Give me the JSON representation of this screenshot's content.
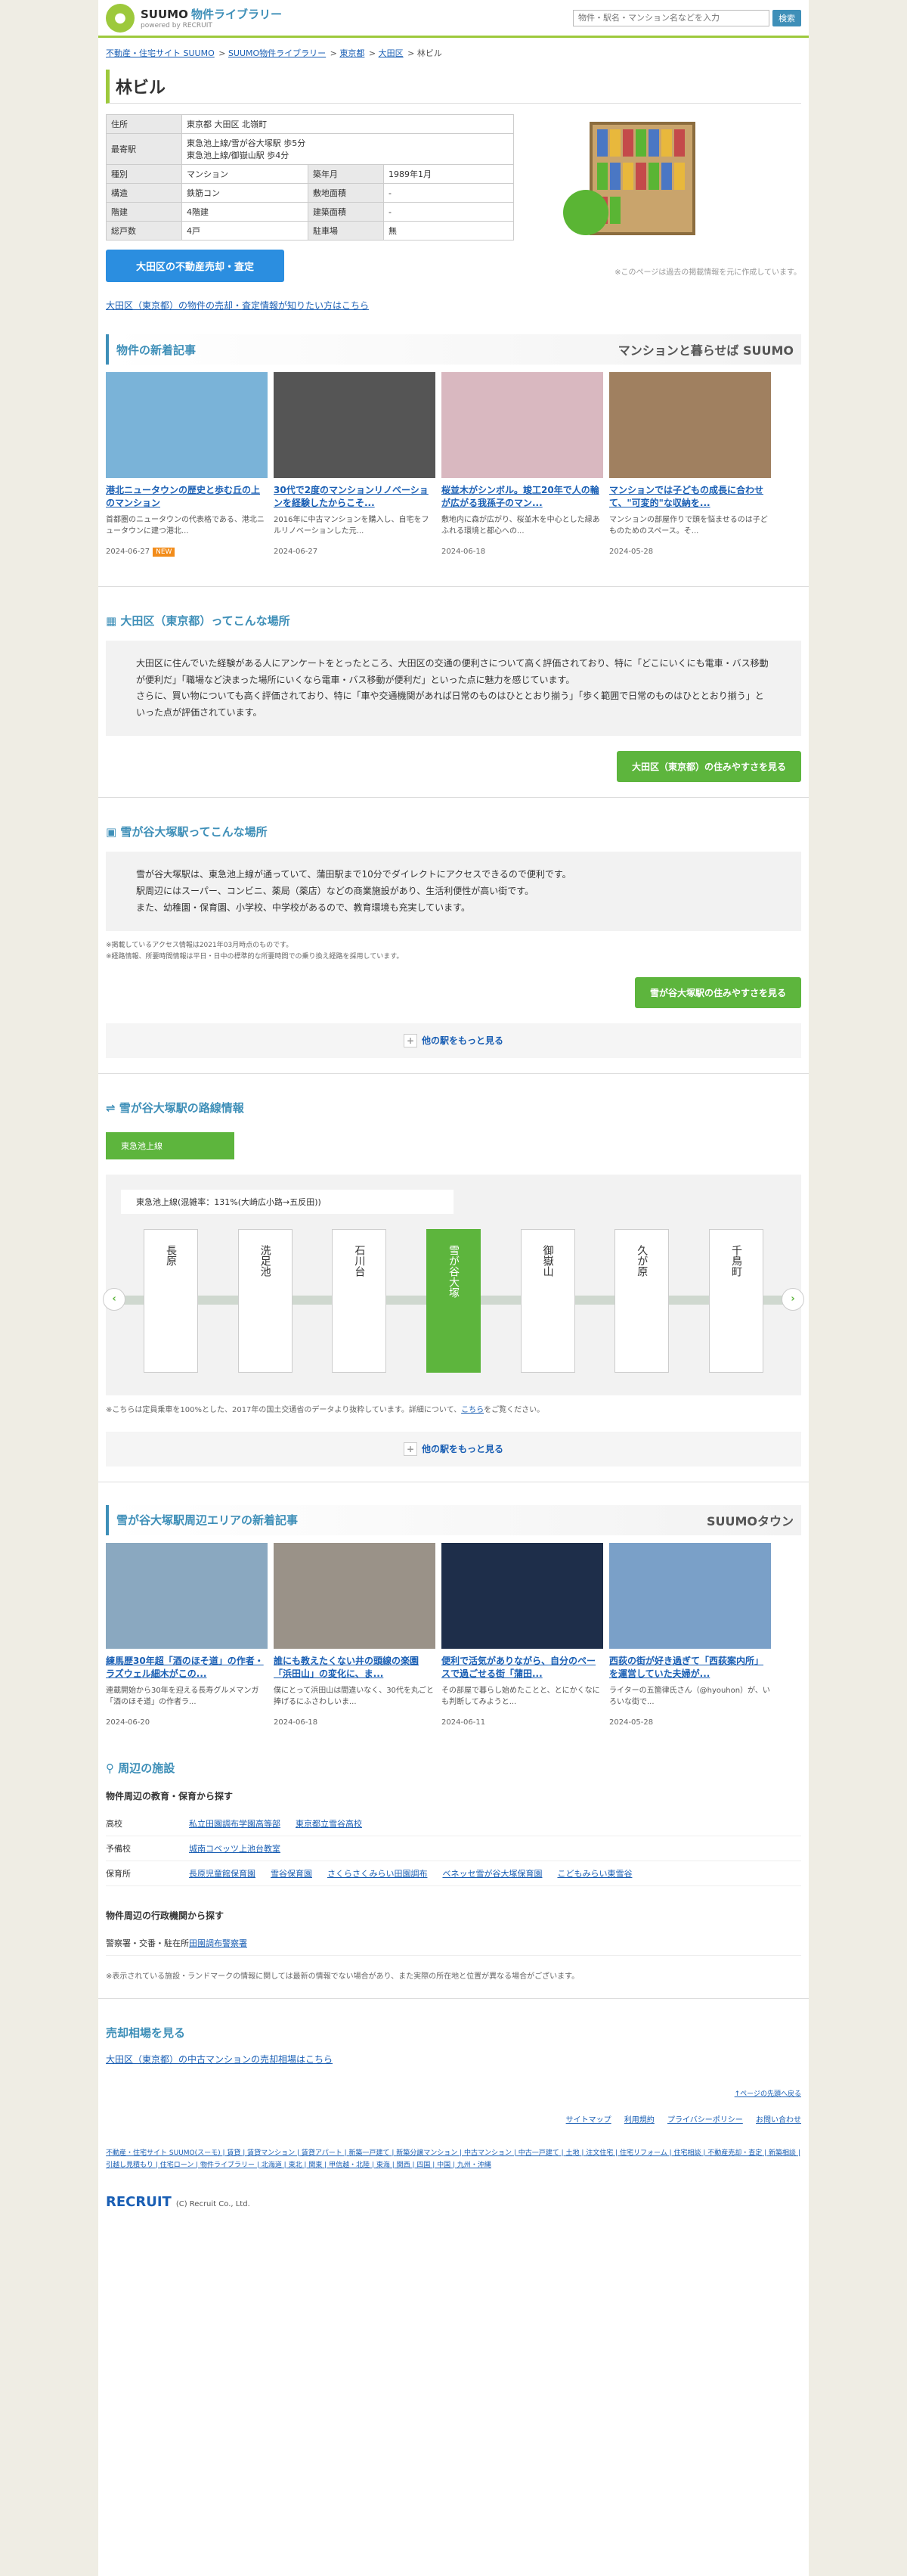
{
  "header": {
    "logo_main": "SUUMO",
    "logo_sub": "物件ライブラリー",
    "logo_tag": "powered by RECRUIT",
    "search_placeholder": "物件・駅名・マンション名などを入力",
    "search_btn": "検索"
  },
  "breadcrumb": [
    "不動産・住宅サイト SUUMO",
    "SUUMO物件ライブラリー",
    "東京都",
    "大田区",
    "林ビル"
  ],
  "title": "林ビル",
  "info": [
    [
      "住所",
      "東京都 大田区 北嶺町",
      "",
      ""
    ],
    [
      "最寄駅",
      "東急池上線/雪が谷大塚駅 歩5分\n東急池上線/御嶽山駅 歩4分",
      "",
      ""
    ],
    [
      "種別",
      "マンション",
      "築年月",
      "1989年1月"
    ],
    [
      "構造",
      "鉄筋コン",
      "敷地面積",
      "-"
    ],
    [
      "階建",
      "4階建",
      "建築面積",
      "-"
    ],
    [
      "総戸数",
      "4戸",
      "駐車場",
      "無"
    ]
  ],
  "sell_btn": "大田区の不動産売却・査定",
  "notice": "※このページは過去の掲載情報を元に作成しています。",
  "sell_link": "大田区（東京都）の物件の売却・査定情報が知りたい方はこちら",
  "news": {
    "title": "物件の新着記事",
    "brand": "マンションと暮らせば SUUMO",
    "cards": [
      {
        "title": "港北ニュータウンの歴史と歩む丘の上のマンション",
        "text": "首都圏のニュータウンの代表格である、港北ニュータウンに建つ港北...",
        "date": "2024-06-27",
        "new": "NEW",
        "color": "#7ab3d8"
      },
      {
        "title": "30代で2度のマンションリノベーションを経験したからこそ...",
        "text": "2016年に中古マンションを購入し、自宅をフルリノベーションした元...",
        "date": "2024-06-27",
        "new": "",
        "color": "#555"
      },
      {
        "title": "桜並木がシンボル。竣工20年で人の輪が広がる我孫子のマン...",
        "text": "敷地内に森が広がり、桜並木を中心とした緑あふれる環境と都心への...",
        "date": "2024-06-18",
        "new": "",
        "color": "#d9b8c0"
      },
      {
        "title": "マンションでは子どもの成長に合わせて、\"可変的\"な収納を...",
        "text": "マンションの部屋作りで頭を悩ませるのは子どものためのスペース。そ...",
        "date": "2024-05-28",
        "new": "",
        "color": "#a08060"
      }
    ]
  },
  "ward": {
    "title": "大田区（東京都）ってこんな場所",
    "text": "大田区に住んでいた経験がある人にアンケートをとったところ、大田区の交通の便利さについて高く評価されており、特に「どこにいくにも電車・バス移動が便利だ」「職場など決まった場所にいくなら電車・バス移動が便利だ」といった点に魅力を感じています。\nさらに、買い物についても高く評価されており、特に「車や交通機関があれば日常のものはひととおり揃う」「歩く範囲で日常のものはひととおり揃う」といった点が評価されています。",
    "btn": "大田区（東京都）の住みやすさを見る"
  },
  "station": {
    "title": "雪が谷大塚駅ってこんな場所",
    "text": "雪が谷大塚駅は、東急池上線が通っていて、蒲田駅まで10分でダイレクトにアクセスできるので便利です。\n駅周辺にはスーパー、コンビニ、薬局（薬店）などの商業施設があり、生活利便性が高い街です。\nまた、幼稚園・保育園、小学校、中学校があるので、教育環境も充実しています。",
    "note1": "※掲載しているアクセス情報は2021年03月時点のものです。",
    "note2": "※経路情報、所要時間情報は平日・日中の標準的な所要時間での乗り換え経路を採用しています。",
    "btn": "雪が谷大塚駅の住みやすさを見る",
    "more": "他の駅をもっと見る"
  },
  "route": {
    "title": "雪が谷大塚駅の路線情報",
    "tab": "東急池上線",
    "label": "東急池上線(混雑率：131%(大崎広小路→五反田))",
    "stations": [
      "長原",
      "洗足池",
      "石川台",
      "雪が谷大塚",
      "御嶽山",
      "久が原",
      "千鳥町"
    ],
    "note": "※こちらは定員乗車を100%とした、2017年の国土交通省のデータより抜粋しています。詳細について、",
    "note_link": "こちら",
    "note_end": "をご覧ください。",
    "more": "他の駅をもっと見る"
  },
  "area_news": {
    "title": "雪が谷大塚駅周辺エリアの新着記事",
    "brand": "SUUMOタウン",
    "cards": [
      {
        "title": "練馬歴30年超「酒のほそ道」の作者・ラズウェル細木がこの...",
        "text": "連載開始から30年を迎える長寿グルメマンガ「酒のほそ道」の作者ラ...",
        "date": "2024-06-20",
        "color": "#8aa8c0"
      },
      {
        "title": "誰にも教えたくない井の頭線の楽園「浜田山」の変化に、ま...",
        "text": "僕にとって浜田山は間違いなく、30代を丸ごと捧げるにふさわしいま...",
        "date": "2024-06-18",
        "color": "#9a9288"
      },
      {
        "title": "便利で活気がありながら、自分のペースで過ごせる街「蒲田...",
        "text": "その部屋で暮らし始めたことと、とにかくなにも判断してみようと...",
        "date": "2024-06-11",
        "color": "#1e2e4a"
      },
      {
        "title": "西荻の街が好き過ぎて「西荻案内所」を運営していた夫婦が...",
        "text": "ライターの五箇律氏さん（@hyouhon）が、いろいな街で...",
        "date": "2024-05-28",
        "color": "#7aa0c8"
      }
    ]
  },
  "facilities": {
    "title": "周辺の施設",
    "edu_title": "物件周辺の教育・保育から探す",
    "rows": [
      {
        "label": "高校",
        "items": [
          "私立田園調布学園高等部",
          "東京都立雪谷高校"
        ]
      },
      {
        "label": "予備校",
        "items": [
          "城南コベッツ上池台教室"
        ]
      },
      {
        "label": "保育所",
        "items": [
          "長原児童館保育園",
          "雪谷保育園",
          "さくらさくみらい田園調布",
          "ベネッセ雪が谷大塚保育園",
          "こどもみらい東雪谷"
        ]
      }
    ],
    "admin_title": "物件周辺の行政機関から探す",
    "admin_rows": [
      {
        "label": "警察署・交番・駐在所",
        "items": [
          "田園調布警察署"
        ]
      }
    ],
    "note": "※表示されている施設・ランドマークの情報に関しては最新の情報でない場合があり、また実際の所在地と位置が異なる場合がございます。"
  },
  "sell": {
    "title": "売却相場を見る",
    "link": "大田区（東京都）の中古マンションの売却相場はこちら"
  },
  "top_link": "↑ページの先頭へ戻る",
  "footer": {
    "links": [
      "サイトマップ",
      "利用規約",
      "プライバシーポリシー",
      "お問い合わせ"
    ],
    "bottom": "不動産・住宅サイト SUUMO(スーモ) | 賃貸 | 賃貸マンション | 賃貸アパート | 新築一戸建て | 新築分譲マンション | 中古マンション | 中古一戸建て | 土地 | 注文住宅 | 住宅リフォーム | 住宅相談 | 不動産売却・査定 | 新築相談 | 引越し見積もり | 住宅ローン | 物件ライブラリー | 北海道 | 東北 | 関東 | 甲信越・北陸 | 東海 | 関西 | 四国 | 中国 | 九州・沖縄",
    "copyright": "(C) Recruit Co., Ltd.",
    "recruit": "RECRUIT"
  }
}
